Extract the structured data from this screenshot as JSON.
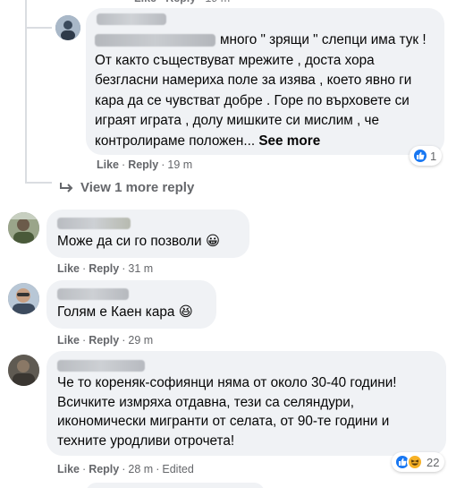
{
  "comments": [
    {
      "text": "много \" зрящи \" слепци има тук ! От както съществуват мрежите , доста хора безгласни намериха поле за изява , което явно ги кара да се чувстват добре . Горе по върховете си играят играта , долу мишките си мислим , че контролираме положен...",
      "see_more": "See more",
      "like": "Like",
      "reply": "Reply",
      "time": "19 m",
      "reaction_count": "1"
    },
    {
      "view_more": "View 1 more reply"
    },
    {
      "text": "Може да си го позволи 😀",
      "like": "Like",
      "reply": "Reply",
      "time": "31 m"
    },
    {
      "text": "Голям е Каен кара 😆",
      "like": "Like",
      "reply": "Reply",
      "time": "29 m"
    },
    {
      "text": "Че то кореняк-софиянци няма от около 30-40 години! Всичките измряха отдавна, тези са селяндури, икономически мигранти от селата, от 90-те години и техните уродливи отрочета!",
      "like": "Like",
      "reply": "Reply",
      "time": "28 m",
      "edited": "Edited",
      "reaction_count": "22"
    }
  ],
  "colors": {
    "bubble": "#f0f2f5",
    "meta": "#65676b",
    "like_blue": "#1877f2",
    "haha_yellow": "#f7b125"
  },
  "icons": [
    "like-reaction-icon",
    "haha-reaction-icon",
    "reply-arrow-icon"
  ]
}
